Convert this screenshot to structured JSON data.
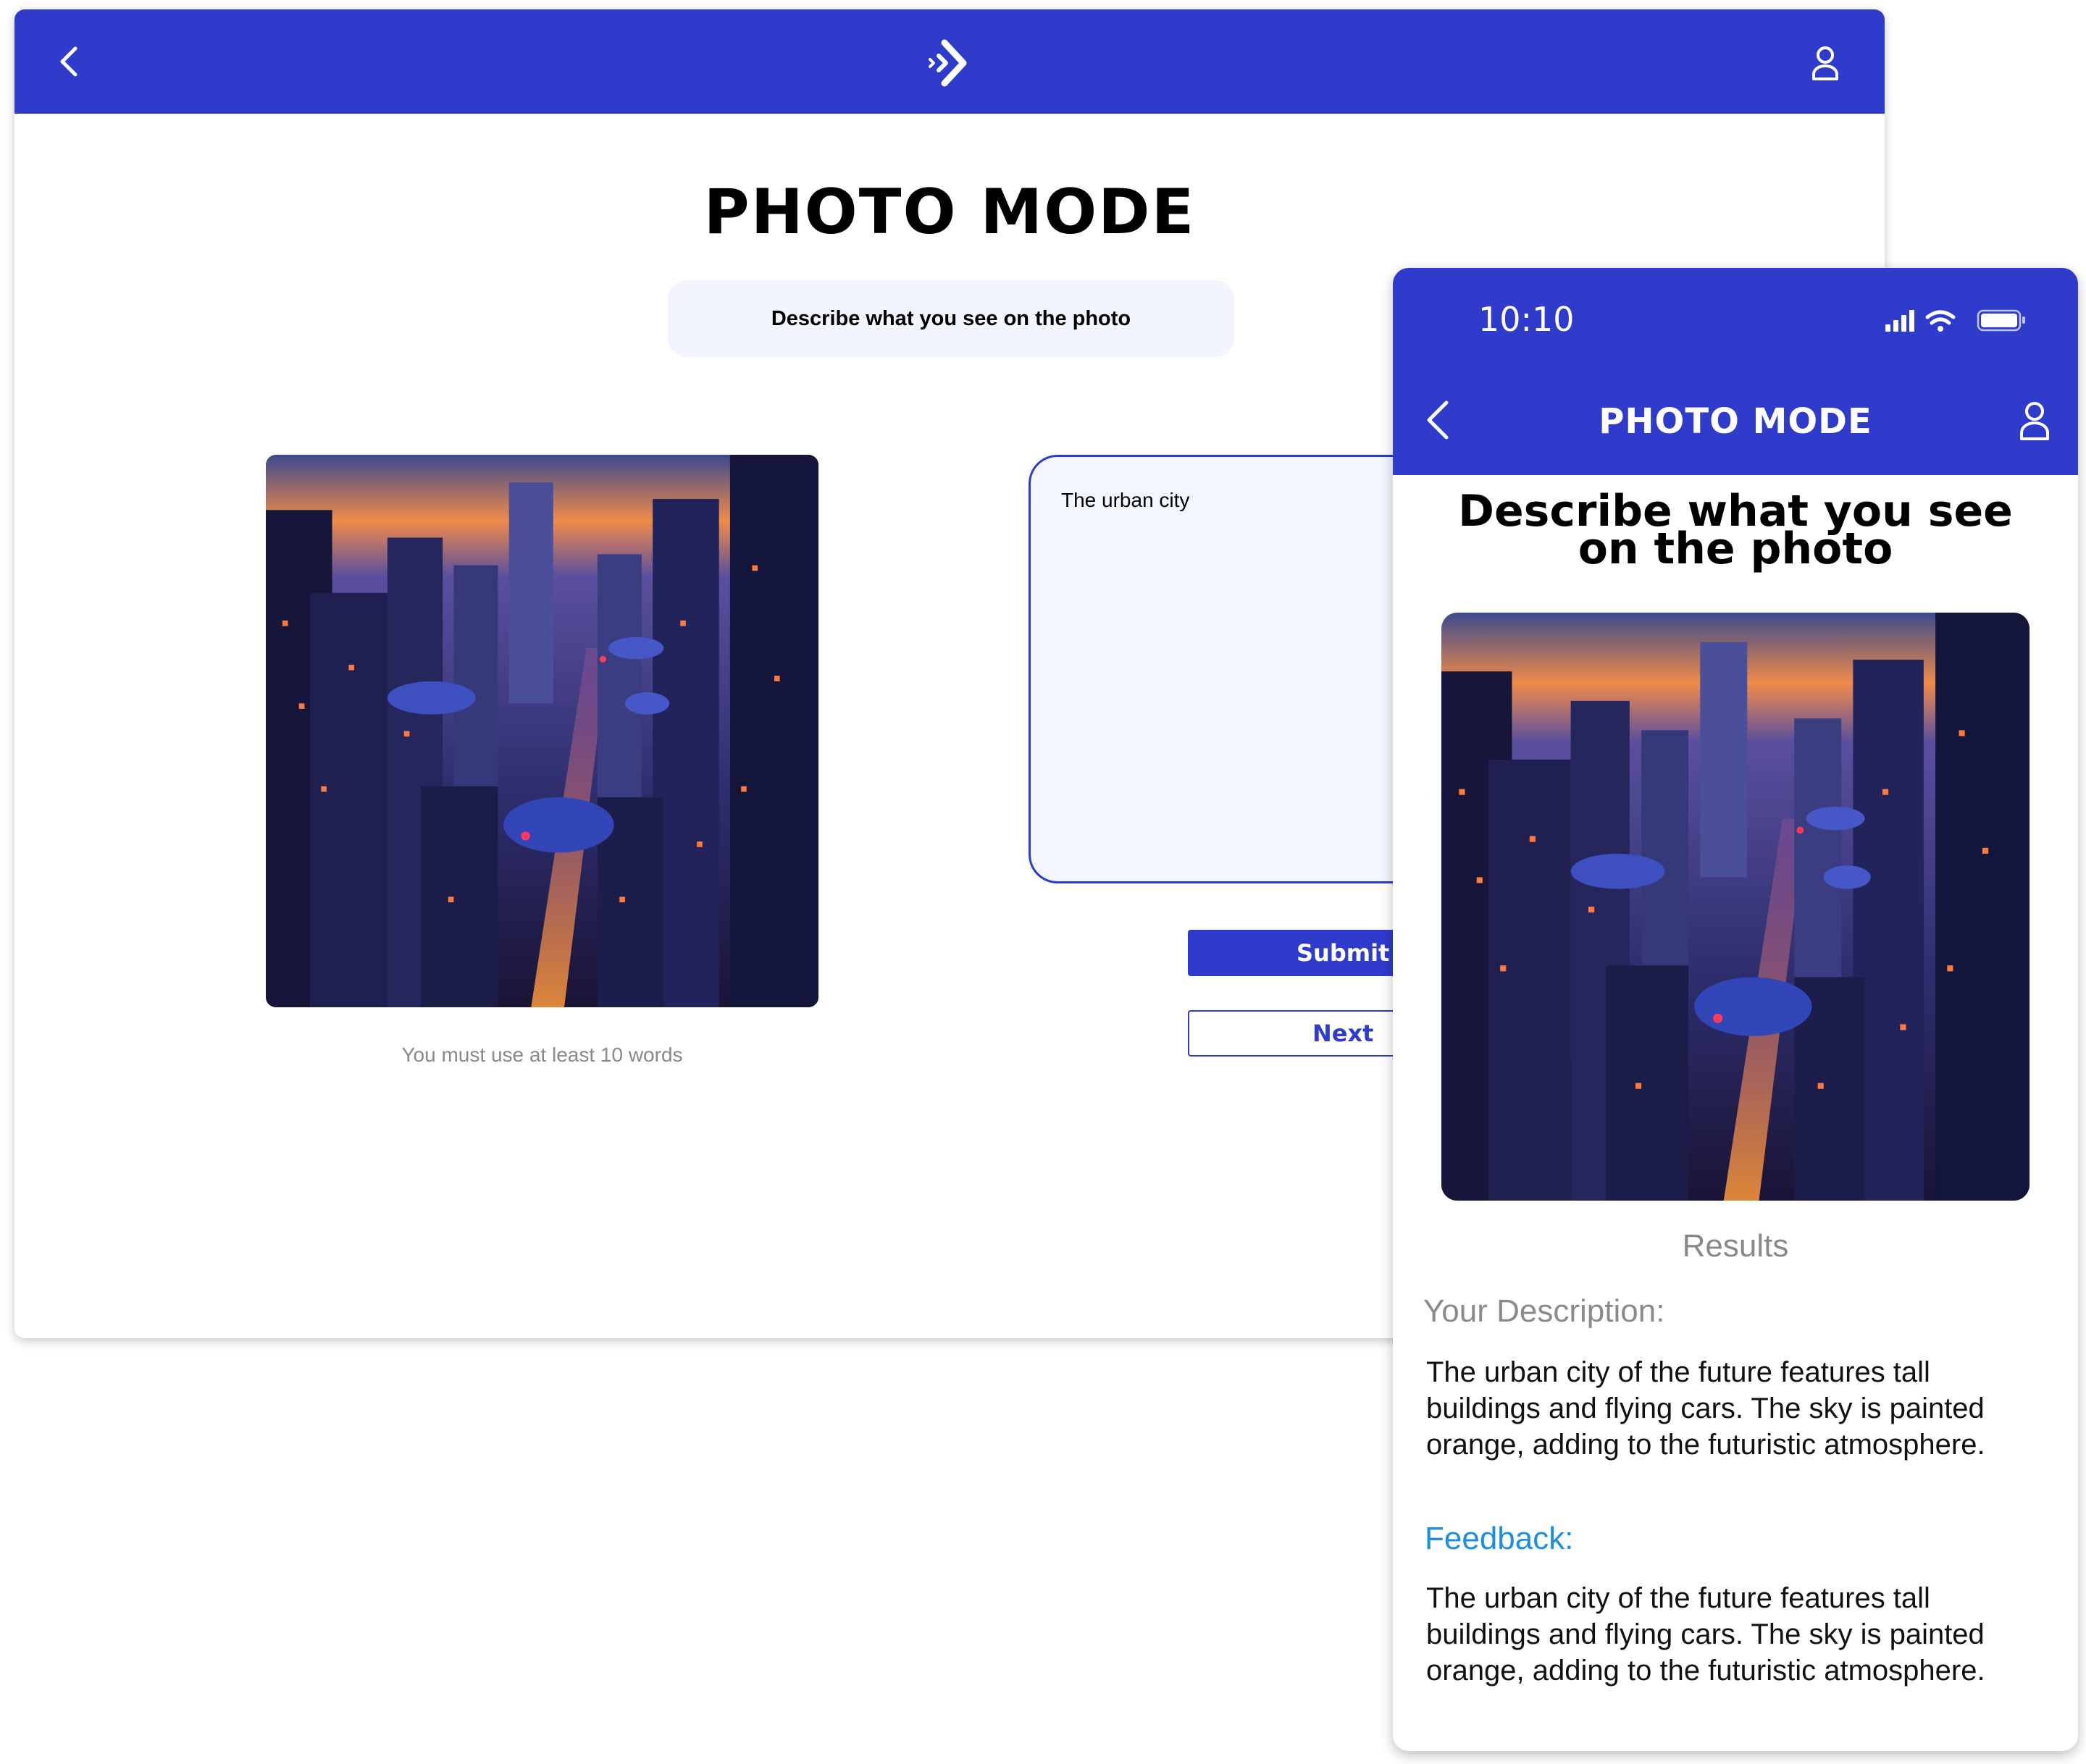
{
  "desktop": {
    "header": {
      "back_icon": "chevron-left-icon",
      "logo_icon": "chevrons-right-logo",
      "user_icon": "user-icon",
      "bar_color": "#2e3bcb"
    },
    "title": "PHOTO MODE",
    "prompt": "Describe what you see on the photo",
    "photo_alt": "futuristic city",
    "hint": "You must use at least 10 words",
    "textarea_value": "The urban city",
    "submit_label": "Submit",
    "next_label": "Next"
  },
  "mobile": {
    "status": {
      "time": "10:10"
    },
    "header_title": "PHOTO MODE",
    "heading": "Describe what you see on the photo",
    "results_label": "Results",
    "description_label": "Your Description:",
    "description_text": "The urban city of the future features tall buildings and flying cars. The sky is painted orange, adding to the futuristic atmosphere.",
    "feedback_label": "Feedback:",
    "feedback_text": "The urban city of the future features tall buildings and flying cars. The sky is painted orange, adding to the futuristic atmosphere.",
    "accent_color": "#2e3bcb",
    "feedback_color": "#1e8ee0"
  }
}
